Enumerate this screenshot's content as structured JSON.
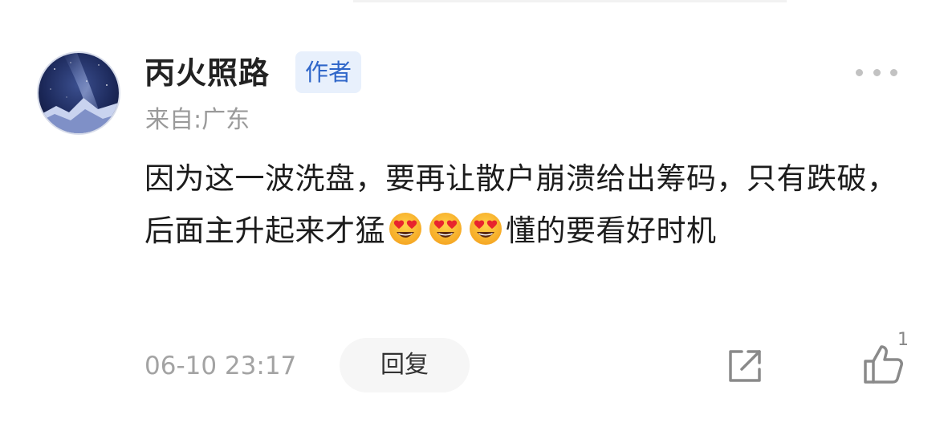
{
  "comment_item": {
    "user": {
      "name": "丙火照路",
      "badge": "作者",
      "location": "来自:广东"
    },
    "content": {
      "text_part1": "因为这一波洗盘，要再让散户崩溃给出筹码，只有跌破，后面主升起来才猛",
      "emoji_name": "heart-eyes-emoji",
      "emoji_count": 3,
      "text_part2": "懂的要看好时机"
    },
    "footer": {
      "timestamp": "06-10 23:17",
      "reply_label": "回复",
      "like_count": "1"
    },
    "icons": {
      "more": "more-dots-icon",
      "share": "share-icon",
      "like": "thumbs-up-icon"
    },
    "colors": {
      "badge_text": "#2f66c9",
      "badge_bg": "#e8f0fc",
      "secondary_text": "#9a9a9a",
      "primary_text": "#1c1c1c"
    }
  }
}
